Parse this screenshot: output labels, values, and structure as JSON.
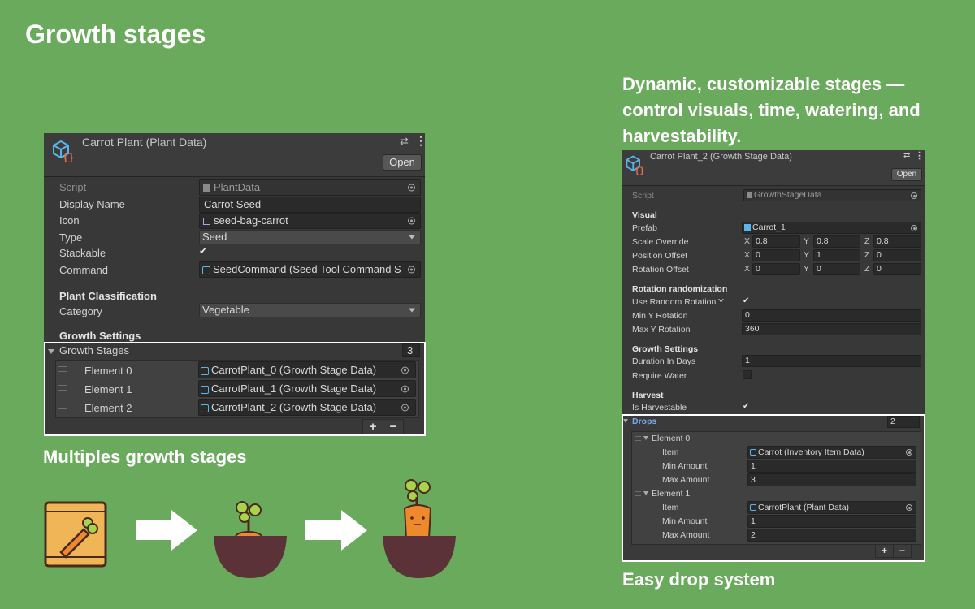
{
  "page": {
    "title": "Growth stages",
    "description": "Dynamic,  customizable  stages — control visuals, time, watering, and harvestability.",
    "caption_left": "Multiples growth stages",
    "caption_right": "Easy drop system"
  },
  "plant_panel": {
    "header_title": "Carrot Plant (Plant Data)",
    "open_label": "Open",
    "script_label": "Script",
    "script_value": "PlantData",
    "display_name_label": "Display Name",
    "display_name_value": "Carrot Seed",
    "icon_label": "Icon",
    "icon_value": "seed-bag-carrot",
    "type_label": "Type",
    "type_value": "Seed",
    "stackable_label": "Stackable",
    "command_label": "Command",
    "command_value": "SeedCommand (Seed Tool Command S",
    "classification_header": "Plant Classification",
    "category_label": "Category",
    "category_value": "Vegetable",
    "growth_settings_header": "Growth Settings",
    "growth_stages_label": "Growth Stages",
    "growth_stages_count": "3",
    "elements": [
      {
        "label": "Element 0",
        "value": "CarrotPlant_0 (Growth Stage Data)"
      },
      {
        "label": "Element 1",
        "value": "CarrotPlant_1 (Growth Stage Data)"
      },
      {
        "label": "Element 2",
        "value": "CarrotPlant_2 (Growth Stage Data)"
      }
    ],
    "plus": "+",
    "minus": "−"
  },
  "stage_panel": {
    "header_title": "Carrot Plant_2 (Growth Stage Data)",
    "open_label": "Open",
    "script_label": "Script",
    "script_value": "GrowthStageData",
    "visual_header": "Visual",
    "prefab_label": "Prefab",
    "prefab_value": "Carrot_1",
    "scale_label": "Scale Override",
    "scale": {
      "x": "0.8",
      "y": "0.8",
      "z": "0.8"
    },
    "position_label": "Position Offset",
    "position": {
      "x": "0",
      "y": "1",
      "z": "0"
    },
    "rotation_label": "Rotation Offset",
    "rotation": {
      "x": "0",
      "y": "0",
      "z": "0"
    },
    "axis": {
      "x": "X",
      "y": "Y",
      "z": "Z"
    },
    "rot_random_header": "Rotation randomization",
    "use_random_label": "Use Random Rotation Y",
    "min_y_label": "Min Y Rotation",
    "min_y_value": "0",
    "max_y_label": "Max Y Rotation",
    "max_y_value": "360",
    "growth_header": "Growth Settings",
    "duration_label": "Duration In Days",
    "duration_value": "1",
    "water_label": "Require Water",
    "harvest_header": "Harvest",
    "harvestable_label": "Is Harvestable",
    "drops_label": "Drops",
    "drops_count": "2",
    "drops": [
      {
        "label": "Element 0",
        "item_label": "Item",
        "item_value": "Carrot (Inventory Item Data)",
        "min_label": "Min Amount",
        "min_value": "1",
        "max_label": "Max Amount",
        "max_value": "3"
      },
      {
        "label": "Element 1",
        "item_label": "Item",
        "item_value": "CarrotPlant (Plant Data)",
        "min_label": "Min Amount",
        "min_value": "1",
        "max_label": "Max Amount",
        "max_value": "2"
      }
    ],
    "plus": "+",
    "minus": "−"
  },
  "colors": {
    "background": "#6aaa5c",
    "panel": "#383838",
    "highlight_box": "#ffffff",
    "drops_label": "#7aa9f0",
    "soil": "#5a3238",
    "carrot": "#ef8a2c",
    "leaf": "#a9d34c"
  }
}
